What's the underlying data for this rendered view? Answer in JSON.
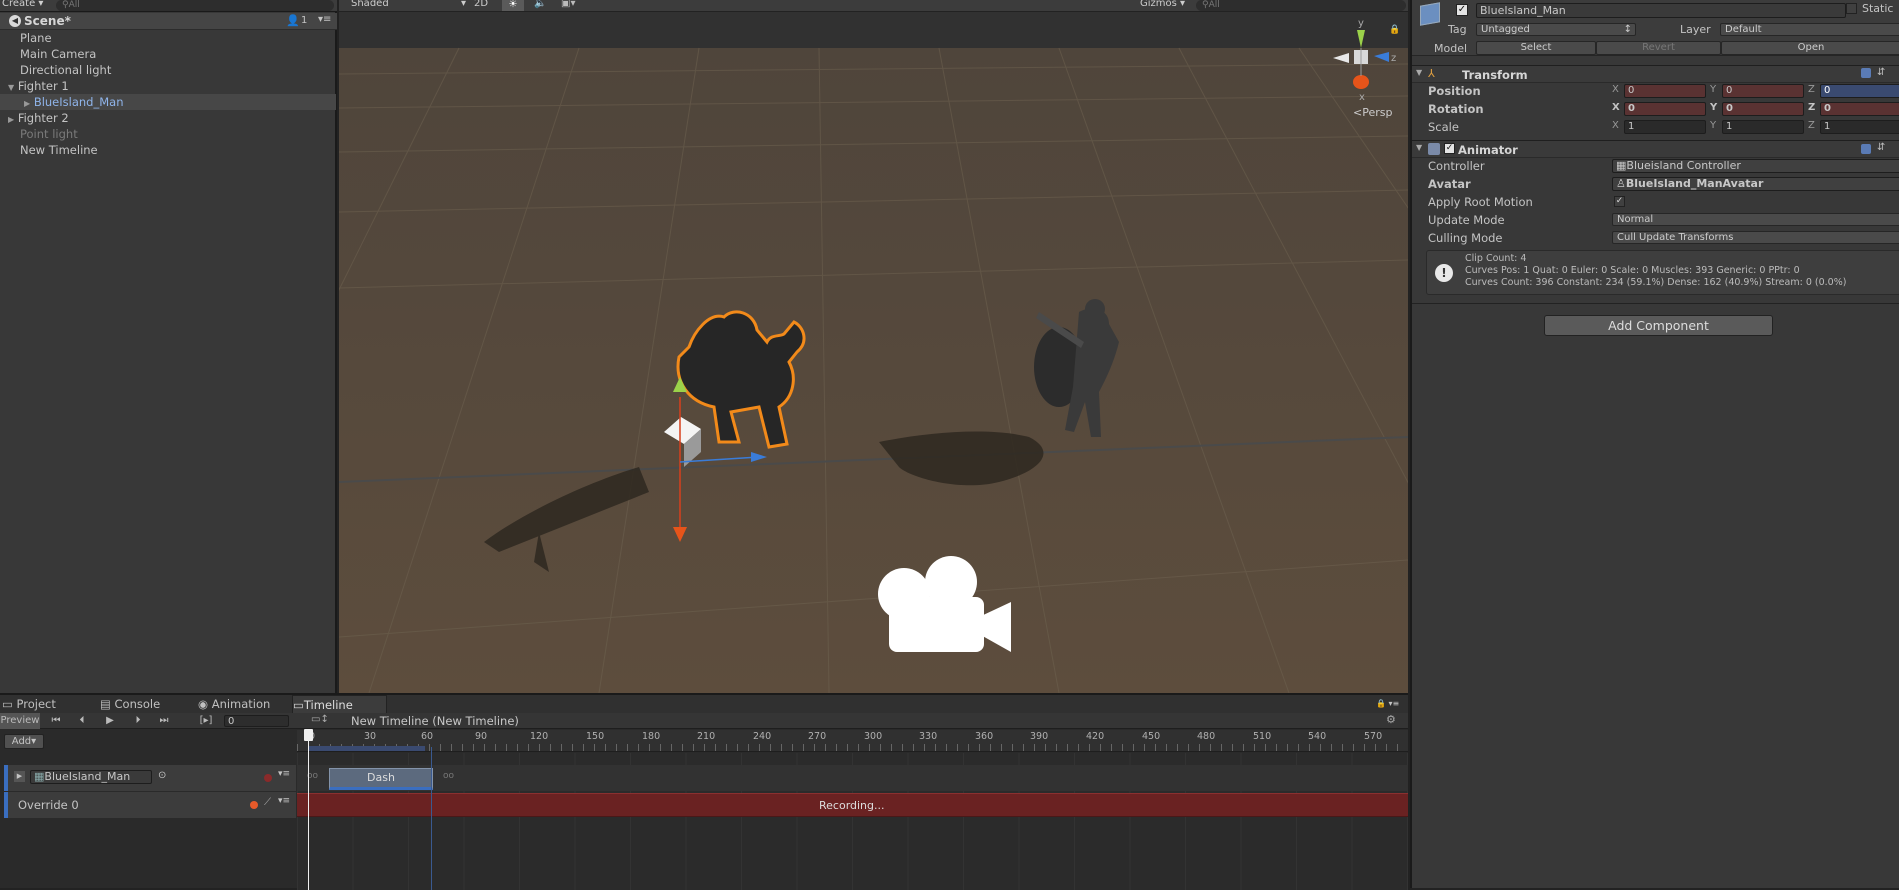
{
  "hierarchy": {
    "create_label": "Create",
    "search_placeholder": "All",
    "scene_name": "Scene*",
    "layers_count": "1",
    "items": [
      {
        "label": "Plane"
      },
      {
        "label": "Main Camera"
      },
      {
        "label": "Directional light"
      },
      {
        "label": "Fighter 1"
      },
      {
        "label": "BlueIsland_Man"
      },
      {
        "label": "Fighter 2"
      },
      {
        "label": "Point light"
      },
      {
        "label": "New Timeline"
      }
    ]
  },
  "scene_view": {
    "shading_mode": "Shaded",
    "mode_2d": "2D",
    "gizmos_label": "Gizmos",
    "search_placeholder": "All",
    "projection_label": "Persp",
    "axis_y": "y",
    "axis_z": "z",
    "axis_x": "x",
    "colors": {
      "ground": "#584a3b",
      "sky": "#313131",
      "selection": "#f28a1a",
      "axis_x": "#d8401c",
      "axis_y": "#9bd24a",
      "axis_z": "#3a7cd8"
    }
  },
  "inspector": {
    "object_name": "BlueIsland_Man",
    "object_active": true,
    "static_label": "Static",
    "tag_label": "Tag",
    "tag_value": "Untagged",
    "layer_label": "Layer",
    "layer_value": "Default",
    "model_label": "Model",
    "model_buttons": [
      "Select",
      "Revert",
      "Open"
    ],
    "transform": {
      "title": "Transform",
      "rows": [
        {
          "label": "Position",
          "x": "0",
          "y": "0",
          "z": "0"
        },
        {
          "label": "Rotation",
          "x": "0",
          "y": "0",
          "z": "0"
        },
        {
          "label": "Scale",
          "x": "1",
          "y": "1",
          "z": "1"
        }
      ],
      "axis_labels": [
        "X",
        "Y",
        "Z"
      ]
    },
    "animator": {
      "title": "Animator",
      "enabled": true,
      "controller_label": "Controller",
      "controller_value": "Blueisland Controller",
      "avatar_label": "Avatar",
      "avatar_value": "BlueIsland_ManAvatar",
      "root_motion_label": "Apply Root Motion",
      "root_motion_checked": true,
      "update_mode_label": "Update Mode",
      "update_mode_value": "Normal",
      "culling_mode_label": "Culling Mode",
      "culling_mode_value": "Cull Update Transforms",
      "info_lines": [
        "Clip Count: 4",
        "Curves Pos: 1 Quat: 0 Euler: 0 Scale: 0 Muscles: 393 Generic: 0 PPtr: 0",
        "Curves Count: 396 Constant: 234 (59.1%) Dense: 162 (40.9%) Stream: 0 (0.0%)"
      ]
    },
    "add_component_label": "Add Component"
  },
  "bottom_tabs": [
    {
      "label": "Project"
    },
    {
      "label": "Console"
    },
    {
      "label": "Animation"
    },
    {
      "label": "Timeline"
    }
  ],
  "timeline": {
    "preview_label": "Preview",
    "frame_value": "0",
    "timeline_name": "New Timeline (New Timeline)",
    "add_label": "Add",
    "ruler_ticks": [
      "0",
      "30",
      "60",
      "90",
      "120",
      "150",
      "180",
      "210",
      "240",
      "270",
      "300",
      "330",
      "360",
      "390",
      "420",
      "450",
      "480",
      "510",
      "540",
      "570"
    ],
    "tracks": [
      {
        "label": "BlueIsland_Man"
      },
      {
        "label": "Override 0"
      }
    ],
    "clip_label": "Dash",
    "recording_label": "Recording..."
  }
}
